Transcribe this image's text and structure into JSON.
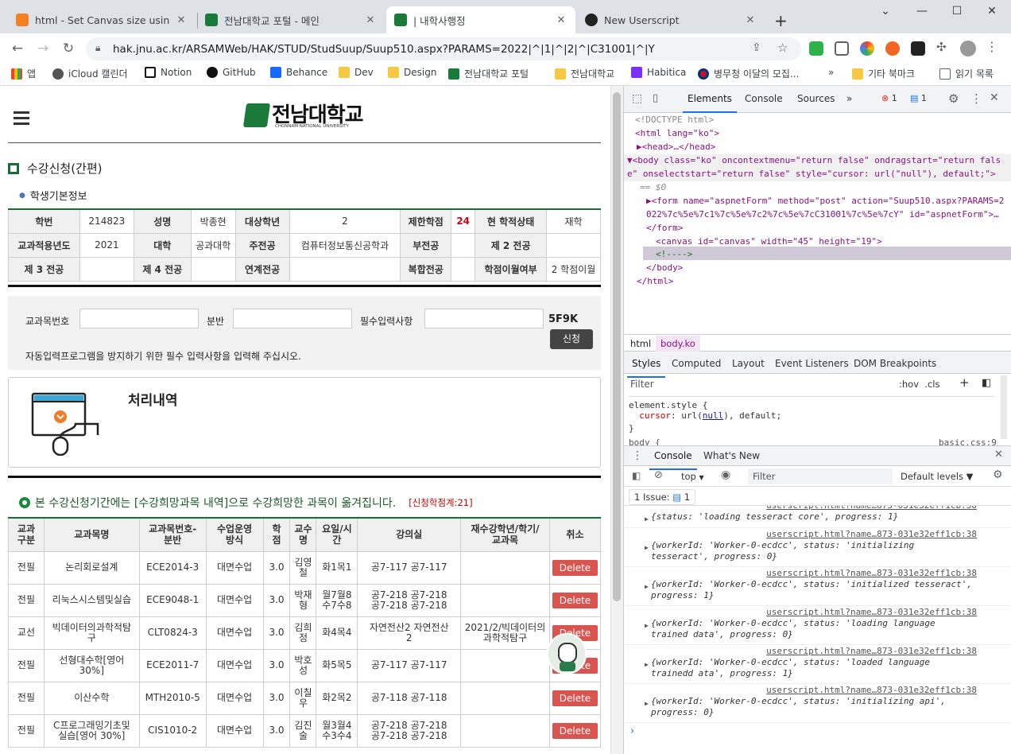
{
  "browser": {
    "tabs": [
      {
        "title": "html - Set Canvas size using jav",
        "favicon_color": "#f48024"
      },
      {
        "title": "전남대학교 포털 - 메인",
        "favicon_color": "#1a7a3a"
      },
      {
        "title": "| 내학사행정",
        "favicon_color": "#1a7a3a"
      },
      {
        "title": "New Userscript",
        "favicon_color": "#222222"
      }
    ],
    "new_tab_label": "+",
    "url": "hak.jnu.ac.kr/ARSAMWeb/HAK/STUD/StudSuup/Suup510.aspx?PARAMS=2022|^|1|^|2|^|C31001|^|Y",
    "bookmarks": [
      "앱",
      "iCloud 캘린더",
      "Notion",
      "GitHub",
      "Behance",
      "Dev",
      "Design",
      "전남대학교 포털",
      "전남대학교",
      "Habitica",
      "병무청 이달의 모집...",
      "»",
      "기타 북마크",
      "읽기 목록"
    ]
  },
  "page": {
    "logo_text": "전남대학교",
    "logo_sub": "CHONNAM NATIONAL UNIVERSITY",
    "section_title": "수강신청(간편)",
    "student_info_title": "학생기본정보",
    "info_rows": [
      [
        "학번",
        "214823",
        "성명",
        "박종현",
        "대상학년",
        "2",
        "제한학점",
        "24",
        "현 학적상태",
        "재학"
      ],
      [
        "교과적용년도",
        "2021",
        "대학",
        "공과대학",
        "주전공",
        "컴퓨터정보통신공학과",
        "부전공",
        "",
        "제 2 전공",
        ""
      ],
      [
        "제 3 전공",
        "",
        "제 4 전공",
        "",
        "연계전공",
        "",
        "복합전공",
        "",
        "학점이월여부",
        "2 학점이월"
      ]
    ],
    "form": {
      "course_no_label": "교과목번호",
      "section_label": "분반",
      "required_label": "필수입력사항",
      "captcha": "5F9K",
      "apply_label": "신청",
      "notice": "자동입력프로그램을 방지하기 위한 필수 입력사항을 입력해 주십시오."
    },
    "process_title": "처리내역",
    "wish_notice": "본 수강신청기간에는 [수강희망과목 내역]으로 수강희망한 과목이 옮겨집니다.",
    "credit_total": "[신청학점계:21]",
    "table_headers": [
      "교과\n구분",
      "교과목명",
      "교과목번호-\n분반",
      "수업운영\n방식",
      "학\n점",
      "교수\n명",
      "요일/시\n간",
      "강의실",
      "재수강학년/학기/\n교과목",
      "취소"
    ],
    "rows": [
      [
        "전필",
        "논리회로설계",
        "ECE2014-3",
        "대면수업",
        "3.0",
        "김영\n철",
        "화1목1",
        "공7-117 공7-117",
        "",
        "Delete"
      ],
      [
        "전필",
        "리눅스시스템및실습",
        "ECE9048-1",
        "대면수업",
        "3.0",
        "박재\n형",
        "월7월8\n수7수8",
        "공7-218 공7-218\n공7-218 공7-218",
        "",
        "Delete"
      ],
      [
        "교선",
        "빅데이터의과학적탐\n구",
        "CLT0824-3",
        "대면수업",
        "3.0",
        "김희\n정",
        "화4목4",
        "자연전산2 자연전산\n2",
        "2021/2/빅데이터의\n과학적탐구",
        "Delete"
      ],
      [
        "전필",
        "선형대수학[영어\n30%]",
        "ECE2011-7",
        "대면수업",
        "3.0",
        "박호\n성",
        "화5목5",
        "공7-117 공7-117",
        "",
        "Delete"
      ],
      [
        "전필",
        "이산수학",
        "MTH2010-5",
        "대면수업",
        "3.0",
        "이칠\n우",
        "화2목2",
        "공7-118 공7-118",
        "",
        "Delete"
      ],
      [
        "전필",
        "C프로그래밍기초및\n실습[영어 30%]",
        "CIS1010-2",
        "대면수업",
        "3.0",
        "김진\n술",
        "월3월4\n수3수4",
        "공7-218 공7-218\n공7-218 공7-218",
        "",
        "Delete"
      ]
    ]
  },
  "devtools": {
    "top_tabs": [
      "Elements",
      "Console",
      "Sources",
      "»"
    ],
    "error_count": "1",
    "issue_count": "1",
    "dom_lines": [
      "<!DOCTYPE html>",
      "<html lang=\"ko\">",
      "▶<head>…</head>",
      "▼<body class=\"ko\" oncontextmenu=\"return false\" ondragstart=\"return false\" onselectstart=\"return false\" style=\"cursor: url(\"null\"), default;\">",
      "== $0",
      "▶<form name=\"aspnetForm\" method=\"post\" action=\"Suup510.aspx?PARAMS=2022%7c%5e%7c1%7c%5e%7c2%7c%5e%7cC31001%7c%5e%7cY\" id=\"aspnetForm\">…",
      "</form>",
      "<canvas id=\"canvas\" width=\"45\" height=\"19\">",
      "<!---->",
      "</body>",
      "</html>"
    ],
    "breadcrumbs": [
      "html",
      "body.ko"
    ],
    "style_tabs": [
      "Styles",
      "Computed",
      "Layout",
      "Event Listeners",
      "DOM Breakpoints"
    ],
    "filter_placeholder": "Filter",
    "hov_cls": ":hov  .cls",
    "element_style": [
      "element.style {",
      "  cursor: url(null), default;",
      "}"
    ],
    "next_rule": "body {",
    "next_rule_src": "basic.css:9",
    "drawer_tabs": [
      "Console",
      "What's New"
    ],
    "console_context": "top",
    "console_filter": "Filter",
    "default_levels": "Default levels ▼",
    "issues_label": "1 Issue:",
    "issues_count": "1",
    "console_src": "userscript.html?name…873-031e32eff1cb:38",
    "console_msgs": [
      "{status: 'loading tesseract core', progress: 1}",
      "{workerId: 'Worker-0-ecdcc', status: 'initializing tesseract', progress: 0}",
      "{workerId: 'Worker-0-ecdcc', status: 'initialized tesseract', progress: 1}",
      "{workerId: 'Worker-0-ecdcc', status: 'loading language trained data', progress: 0}",
      "{workerId: 'Worker-0-ecdcc', status: 'loaded language trainedd ata', progress: 1}",
      "{workerId: 'Worker-0-ecdcc', status: 'initializing api', progress: 0}"
    ]
  }
}
